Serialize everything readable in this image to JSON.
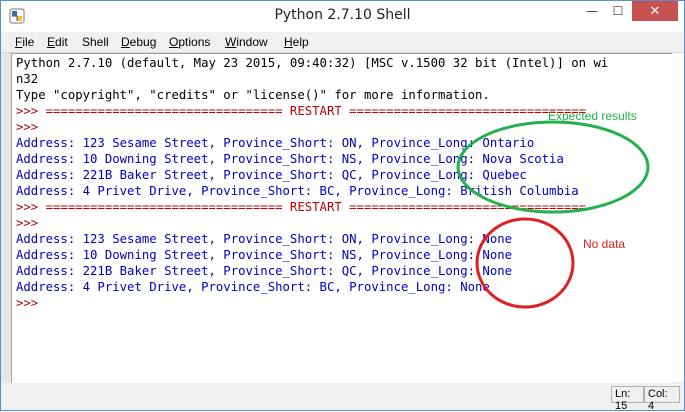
{
  "window": {
    "title": "Python 2.7.10 Shell",
    "close_label": "✕",
    "min_label": "—",
    "max_label": "☐"
  },
  "menu": {
    "items": [
      {
        "label": "File",
        "mnemonic": "F",
        "rest": "ile"
      },
      {
        "label": "Edit",
        "mnemonic": "E",
        "rest": "dit"
      },
      {
        "label": "Shell",
        "mnemonic": "",
        "rest": "Shell"
      },
      {
        "label": "Debug",
        "mnemonic": "D",
        "rest": "ebug"
      },
      {
        "label": "Options",
        "mnemonic": "O",
        "rest": "ptions"
      },
      {
        "label": "Window",
        "mnemonic": "W",
        "rest": "indow"
      },
      {
        "label": "Help",
        "mnemonic": "H",
        "rest": "elp"
      }
    ]
  },
  "shell": {
    "lines": [
      {
        "text": "Python 2.7.10 (default, May 23 2015, 09:40:32) [MSC v.1500 32 bit (Intel)] on wi",
        "style": "black"
      },
      {
        "text": "n32",
        "style": "black"
      },
      {
        "text": "Type \"copyright\", \"credits\" or \"license()\" for more information.",
        "style": "black"
      },
      {
        "text": ">>> ================================ RESTART ================================",
        "style": "red"
      },
      {
        "text": ">>> ",
        "style": "red"
      },
      {
        "text": "Address: 123 Sesame Street, Province_Short: ON, Province_Long: Ontario",
        "style": "blue"
      },
      {
        "text": "Address: 10 Downing Street, Province_Short: NS, Province_Long: Nova Scotia",
        "style": "blue"
      },
      {
        "text": "Address: 221B Baker Street, Province_Short: QC, Province_Long: Quebec",
        "style": "blue"
      },
      {
        "text": "Address: 4 Privet Drive, Province_Short: BC, Province_Long: British Columbia",
        "style": "blue"
      },
      {
        "text": ">>> ================================ RESTART ================================",
        "style": "red"
      },
      {
        "text": ">>> ",
        "style": "red"
      },
      {
        "text": "Address: 123 Sesame Street, Province_Short: ON, Province_Long: None",
        "style": "blue"
      },
      {
        "text": "Address: 10 Downing Street, Province_Short: NS, Province_Long: None",
        "style": "blue"
      },
      {
        "text": "Address: 221B Baker Street, Province_Short: QC, Province_Long: None",
        "style": "blue"
      },
      {
        "text": "Address: 4 Privet Drive, Province_Short: BC, Province_Long: None",
        "style": "blue"
      },
      {
        "text": ">>> ",
        "style": "red"
      }
    ]
  },
  "status": {
    "line": "Ln: 15",
    "col": "Col: 4"
  },
  "annotations": {
    "expected": "Expected results",
    "nodata": "No data",
    "green": "#22b14c",
    "red": "#e02020"
  },
  "colors": {
    "prompt": "#c00000",
    "output": "#0000c0",
    "text": "#000000",
    "close_button": "#c75050"
  }
}
